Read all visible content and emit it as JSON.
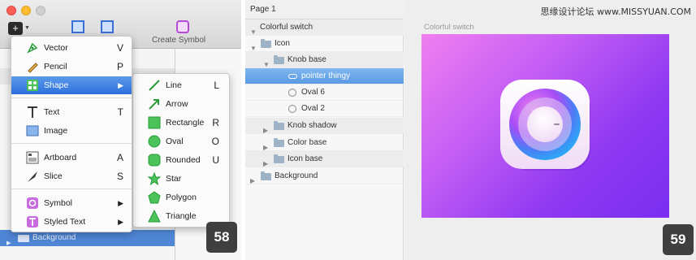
{
  "watermark": "思缘设计论坛 www.MISSYUAN.COM",
  "left": {
    "toolbar": {
      "create_symbol_label": "Create Symbol"
    },
    "background_layer_label": "Background",
    "insert_menu": [
      {
        "label": "Vector",
        "shortcut": "V",
        "icon": "vector-pen-icon"
      },
      {
        "label": "Pencil",
        "shortcut": "P",
        "icon": "pencil-icon"
      },
      {
        "label": "Shape",
        "shortcut": "▶",
        "icon": "shape-icon",
        "selected": true
      },
      {
        "label": "Text",
        "shortcut": "T",
        "icon": "text-icon"
      },
      {
        "label": "Image",
        "shortcut": "",
        "icon": "image-icon"
      },
      {
        "label": "Artboard",
        "shortcut": "A",
        "icon": "artboard-icon"
      },
      {
        "label": "Slice",
        "shortcut": "S",
        "icon": "slice-knife-icon"
      },
      {
        "label": "Symbol",
        "shortcut": "▶",
        "icon": "symbol-icon"
      },
      {
        "label": "Styled Text",
        "shortcut": "▶",
        "icon": "styled-text-icon"
      }
    ],
    "shape_submenu": [
      {
        "label": "Line",
        "shortcut": "L"
      },
      {
        "label": "Arrow",
        "shortcut": ""
      },
      {
        "label": "Rectangle",
        "shortcut": "R"
      },
      {
        "label": "Oval",
        "shortcut": "O"
      },
      {
        "label": "Rounded",
        "shortcut": "U"
      },
      {
        "label": "Star",
        "shortcut": ""
      },
      {
        "label": "Polygon",
        "shortcut": ""
      },
      {
        "label": "Triangle",
        "shortcut": ""
      }
    ],
    "step_badge": "58"
  },
  "right": {
    "page_label": "Page 1",
    "layers": [
      {
        "label": "Colorful switch",
        "type": "artboard"
      },
      {
        "label": "Icon",
        "type": "group"
      },
      {
        "label": "Knob base",
        "type": "group"
      },
      {
        "label": "pointer thingy",
        "type": "shape",
        "selected": true
      },
      {
        "label": "Oval 6",
        "type": "oval"
      },
      {
        "label": "Oval 2",
        "type": "oval"
      },
      {
        "label": "Knob shadow",
        "type": "group"
      },
      {
        "label": "Color base",
        "type": "group"
      },
      {
        "label": "Icon base",
        "type": "group"
      },
      {
        "label": "Background",
        "type": "group"
      }
    ],
    "artboard_label": "Colorful switch",
    "step_badge": "59"
  }
}
